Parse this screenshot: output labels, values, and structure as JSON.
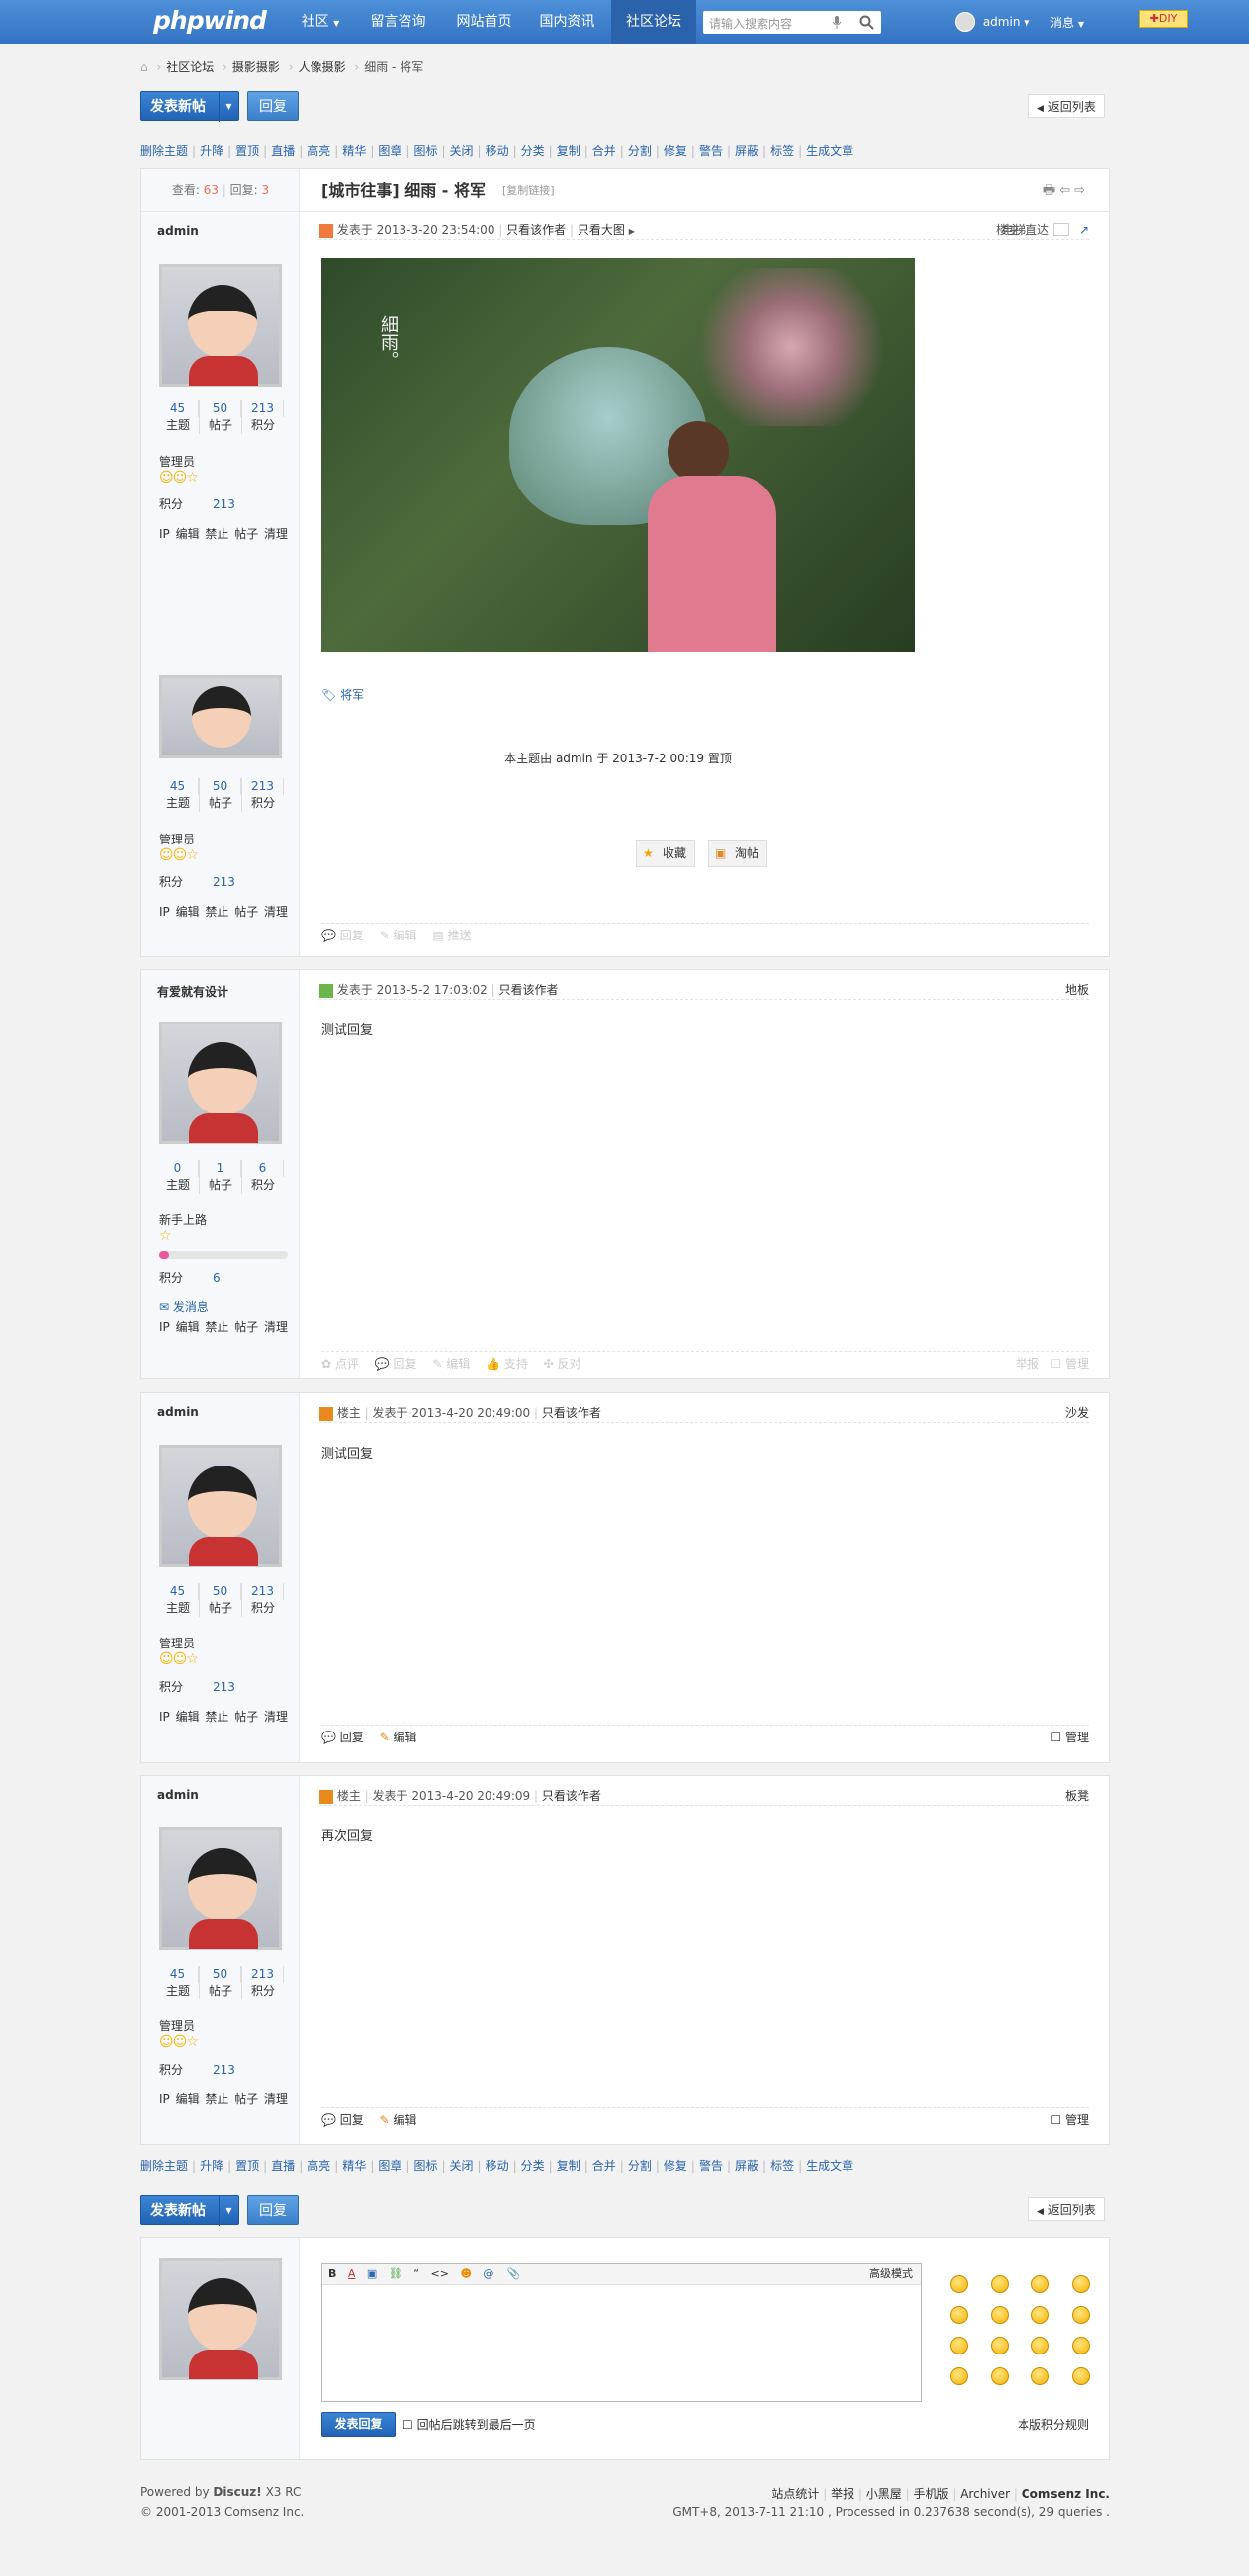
{
  "topbar": {
    "logo": "phpwind",
    "nav": [
      "社区",
      "留言咨询",
      "网站首页",
      "国内资讯",
      "社区论坛"
    ],
    "search_placeholder": "请输入搜索内容",
    "user": "admin",
    "messages": "消息",
    "diy": "DIY"
  },
  "breadcrumb": [
    "社区论坛",
    "摄影摄影",
    "人像摄影",
    "细雨 - 将军"
  ],
  "actions": {
    "post": "发表新帖",
    "reply": "回复",
    "back": "返回列表"
  },
  "modbar": [
    "删除主题",
    "升降",
    "置顶",
    "直播",
    "高亮",
    "精华",
    "图章",
    "图标",
    "关闭",
    "移动",
    "分类",
    "复制",
    "合并",
    "分割",
    "修复",
    "警告",
    "屏蔽",
    "标签",
    "生成文章"
  ],
  "thread": {
    "views_label": "查看:",
    "views": "63",
    "replies_label": "回复:",
    "replies": "3",
    "title": "[城市往事] 细雨 - 将军",
    "copy_link": "[复制链接]",
    "print_icons": [
      "print-icon",
      "prev-icon",
      "next-icon"
    ]
  },
  "first_post": {
    "author": "admin",
    "posted": "发表于 2013-3-20 23:54:00",
    "only_author": "只看该作者",
    "big_image": "只看大图",
    "floor": "楼主",
    "elevator": "电梯直达",
    "tag": "将军",
    "pinned_note": "本主题由 admin 于 2013-7-2 00:19 置顶",
    "favorite": "收藏",
    "share": "淘帖",
    "foot": [
      "回复",
      "编辑",
      "推送"
    ],
    "image_text": "細雨。"
  },
  "user_admin": {
    "stats": [
      {
        "num": "45",
        "label": "主题"
      },
      {
        "num": "50",
        "label": "帖子"
      },
      {
        "num": "213",
        "label": "积分"
      }
    ],
    "rank": "管理员",
    "points_label": "积分",
    "points": "213",
    "ops": "IP 编辑 禁止 帖子 清理"
  },
  "post2": {
    "author": "有爱就有设计",
    "posted": "发表于 2013-5-2 17:03:02",
    "only_author": "只看该作者",
    "floor": "地板",
    "content": "测试回复",
    "stats": [
      {
        "num": "0",
        "label": "主题"
      },
      {
        "num": "1",
        "label": "帖子"
      },
      {
        "num": "6",
        "label": "积分"
      }
    ],
    "rank": "新手上路",
    "rank_progress": 0.08,
    "points_label": "积分",
    "points": "6",
    "message": "发消息",
    "ops": "IP 编辑 禁止 帖子 清理",
    "foot": [
      "点评",
      "回复",
      "编辑",
      "支持",
      "反对"
    ],
    "foot_right": [
      "举报",
      "管理"
    ]
  },
  "post3": {
    "author": "admin",
    "owner": "楼主",
    "posted": "发表于 2013-4-20 20:49:00",
    "only_author": "只看该作者",
    "floor": "沙发",
    "content": "测试回复",
    "foot": [
      "回复",
      "编辑"
    ],
    "manage": "管理"
  },
  "post4": {
    "author": "admin",
    "owner": "楼主",
    "posted": "发表于 2013-4-20 20:49:09",
    "only_author": "只看该作者",
    "floor": "板凳",
    "content": "再次回复",
    "foot": [
      "回复",
      "编辑"
    ],
    "manage": "管理"
  },
  "editor": {
    "tools": [
      "B",
      "A",
      "image-icon",
      "link-icon",
      "“",
      "<>",
      "emoji-icon",
      "@",
      "attach-icon"
    ],
    "advanced": "高级模式",
    "submit": "发表回复",
    "jump": "回帖后跳转到最后一页",
    "rules": "本版积分规则"
  },
  "footer": {
    "powered": "Powered by",
    "discuz": "Discuz!",
    "version": "X3 RC",
    "copyright": "© 2001-2013 Comsenz Inc.",
    "links": [
      "站点统计",
      "举报",
      "小黑屋",
      "手机版",
      "Archiver",
      "Comsenz Inc."
    ],
    "info": "GMT+8, 2013-7-11 21:10 , Processed in 0.237638 second(s), 29 queries ."
  },
  "colors": {
    "brand": "#3a7bcf",
    "link": "#2a64ae",
    "counter": "#f26c4f"
  }
}
